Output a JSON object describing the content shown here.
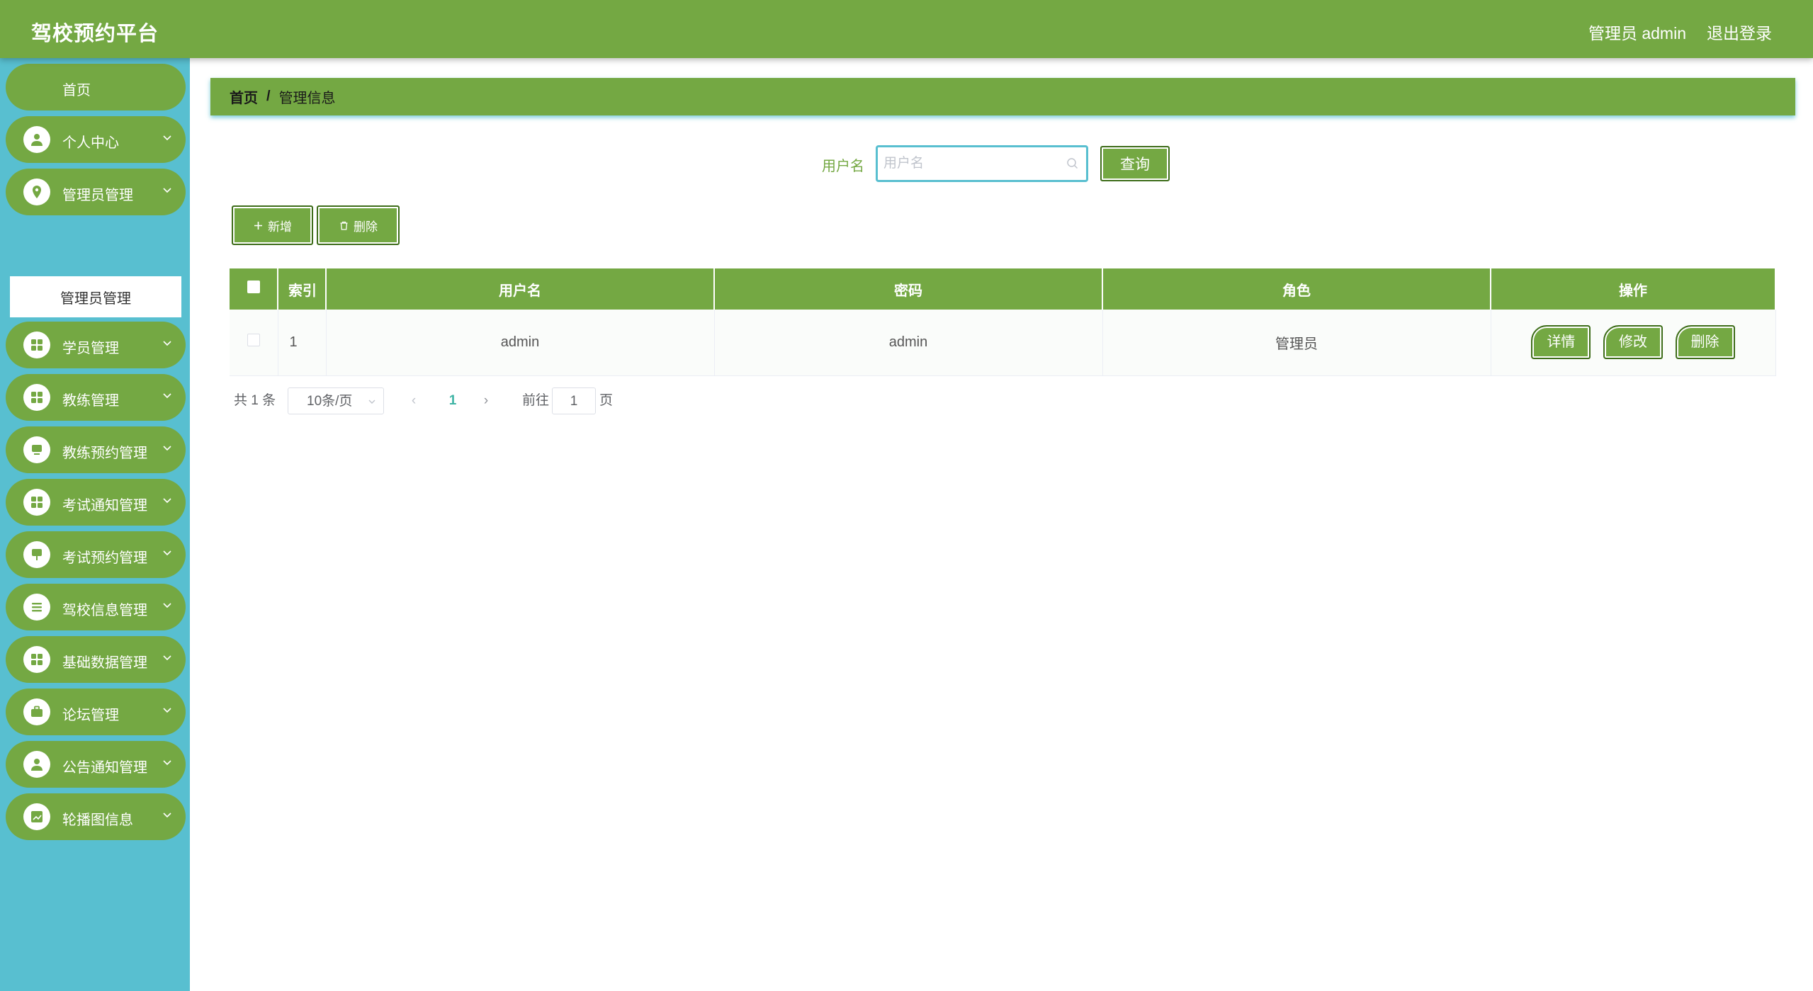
{
  "header": {
    "title": "驾校预约平台",
    "user": "管理员 admin",
    "logout": "退出登录"
  },
  "sidebar": {
    "items": [
      {
        "label": "首页",
        "icon": "home"
      },
      {
        "label": "个人中心",
        "icon": "user-icon"
      },
      {
        "label": "管理员管理",
        "icon": "location-icon"
      },
      {
        "label": "学员管理",
        "icon": "grid-icon"
      },
      {
        "label": "教练管理",
        "icon": "grid-icon"
      },
      {
        "label": "教练预约管理",
        "icon": "monitor-icon"
      },
      {
        "label": "考试通知管理",
        "icon": "grid-icon"
      },
      {
        "label": "考试预约管理",
        "icon": "sign-icon"
      },
      {
        "label": "驾校信息管理",
        "icon": "list-icon"
      },
      {
        "label": "基础数据管理",
        "icon": "grid-icon"
      },
      {
        "label": "论坛管理",
        "icon": "briefcase-icon"
      },
      {
        "label": "公告通知管理",
        "icon": "user-icon"
      },
      {
        "label": "轮播图信息",
        "icon": "chart-icon"
      }
    ],
    "submenu_active": "管理员管理"
  },
  "breadcrumb": {
    "home": "首页",
    "separator": "/",
    "current": "管理信息"
  },
  "search": {
    "label": "用户名",
    "placeholder": "用户名",
    "value": "",
    "button": "查询"
  },
  "actions": {
    "add": "新增",
    "delete": "删除"
  },
  "table": {
    "columns": [
      "",
      "索引",
      "用户名",
      "密码",
      "角色",
      "操作"
    ],
    "rows": [
      {
        "index": "1",
        "username": "admin",
        "password": "admin",
        "role": "管理员"
      }
    ],
    "row_actions": [
      "详情",
      "修改",
      "删除"
    ]
  },
  "pagination": {
    "total": "共 1 条",
    "page_size": "10条/页",
    "prev": "‹",
    "current": "1",
    "next": "›",
    "goto_label": "前往",
    "goto_value": "1",
    "goto_suffix": "页"
  },
  "colors": {
    "primary": "#74a843",
    "sidebar_bg": "#58bfd0",
    "page_active": "#3fb4a5"
  }
}
